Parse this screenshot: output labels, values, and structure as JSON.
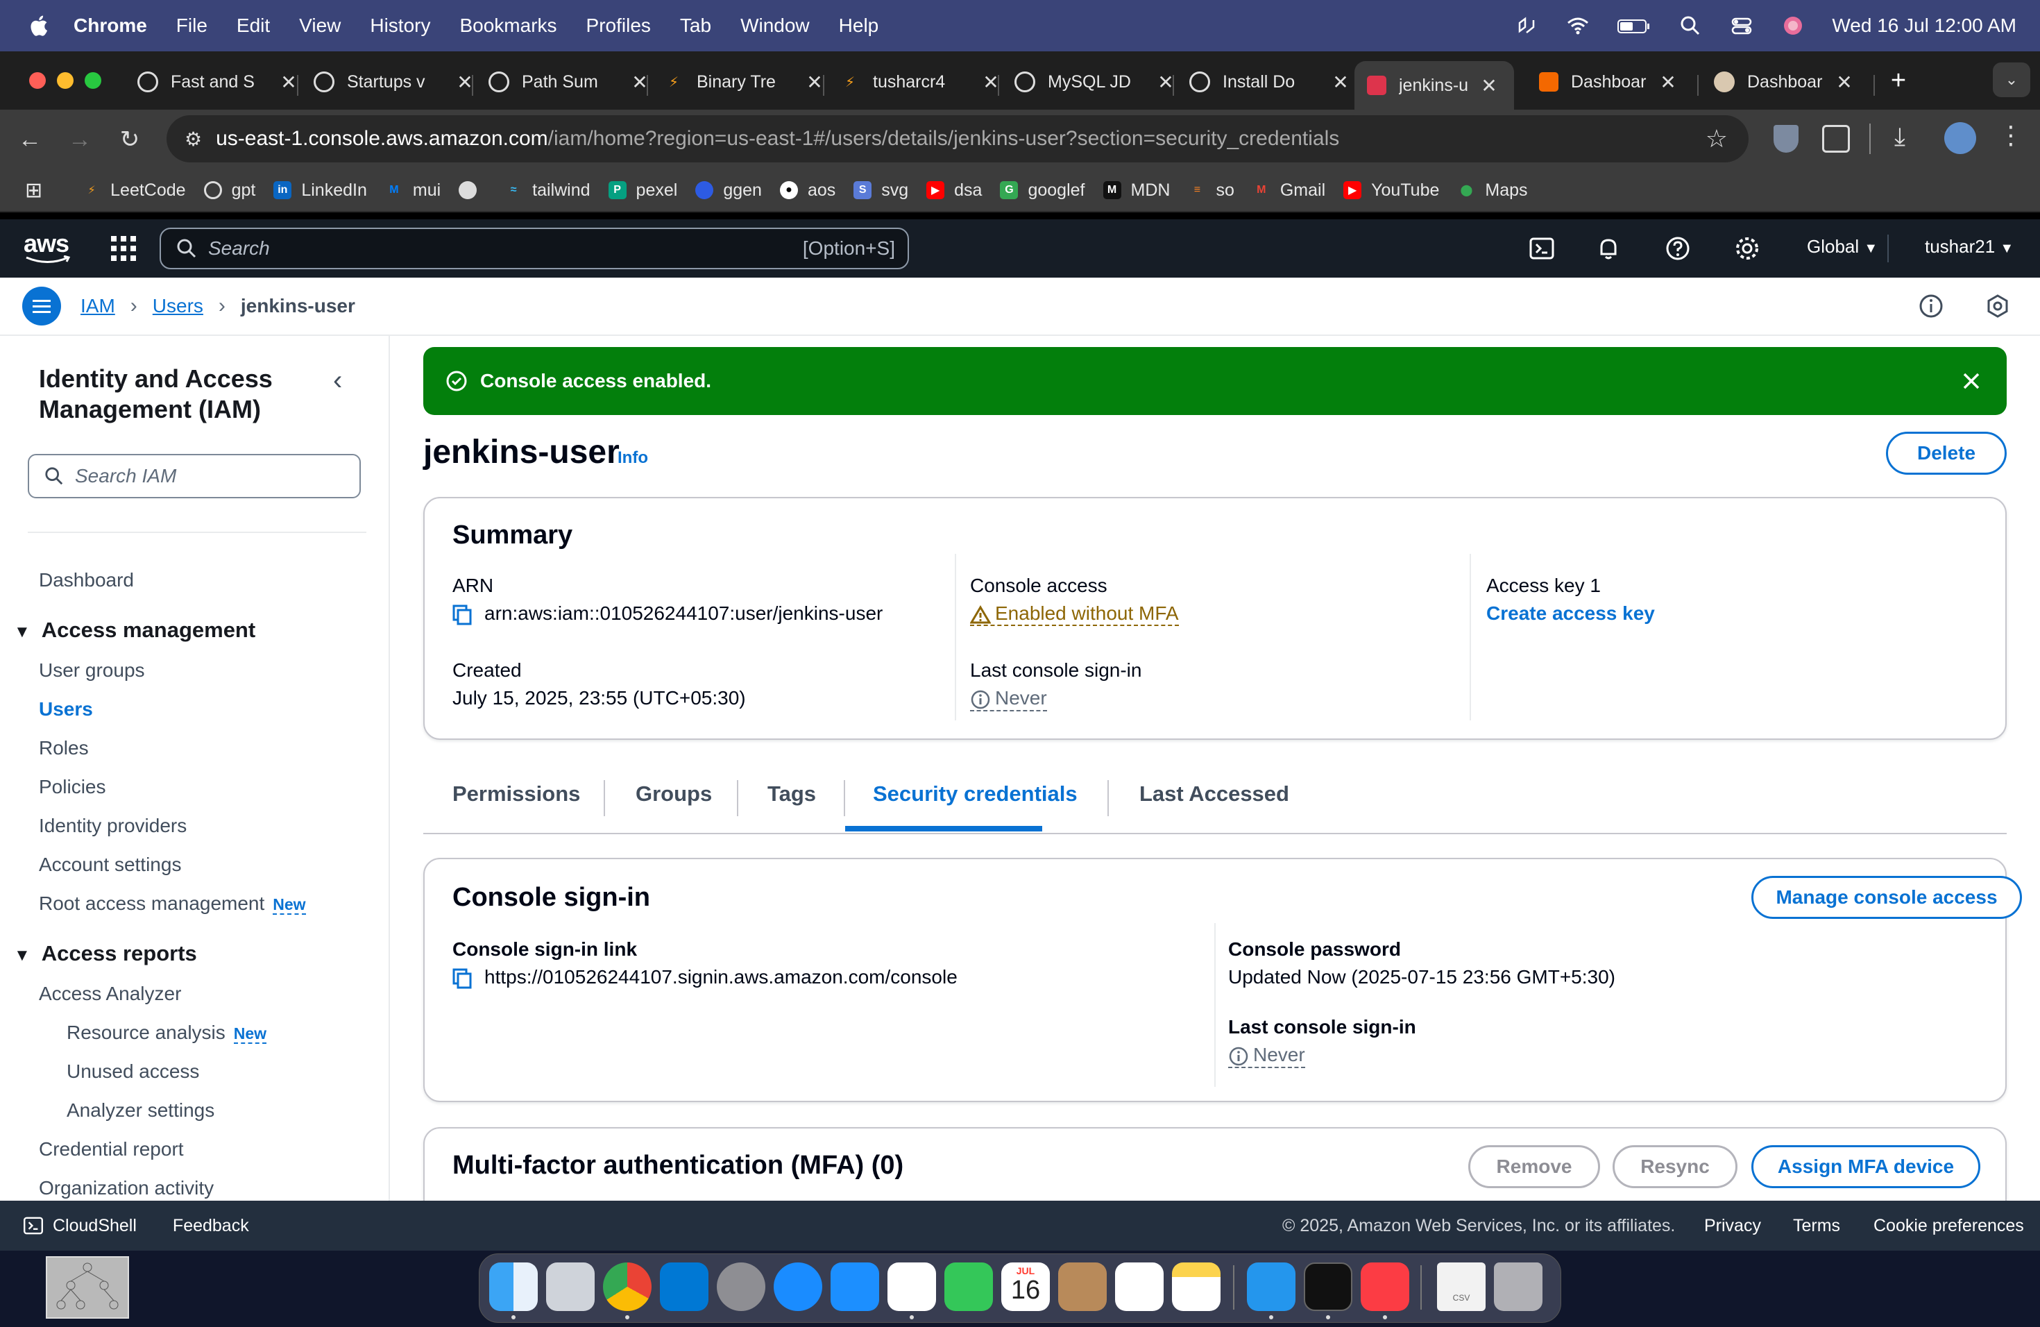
{
  "menubar": {
    "app_name": "Chrome",
    "items": [
      "File",
      "Edit",
      "View",
      "History",
      "Bookmarks",
      "Profiles",
      "Tab",
      "Window",
      "Help"
    ],
    "datetime": "Wed 16 Jul  12:00 AM"
  },
  "tabs": [
    {
      "label": "Fast and S",
      "icon": "openai-icon"
    },
    {
      "label": "Startups v",
      "icon": "openai-icon"
    },
    {
      "label": "Path Sum",
      "icon": "openai-icon"
    },
    {
      "label": "Binary Tre",
      "icon": "leetcode-icon"
    },
    {
      "label": "tusharcr4",
      "icon": "leetcode-icon"
    },
    {
      "label": "MySQL JD",
      "icon": "openai-icon"
    },
    {
      "label": "Install Do",
      "icon": "openai-icon"
    },
    {
      "label": "jenkins-u",
      "icon": "aws-iam-icon",
      "active": true
    },
    {
      "label": "Dashboar",
      "icon": "orange-dashboard-icon"
    },
    {
      "label": "Dashboar",
      "icon": "jenkins-icon"
    }
  ],
  "address": {
    "host": "us-east-1.console.aws.amazon.com",
    "path": "/iam/home?region=us-east-1#/users/details/jenkins-user?section=security_credentials"
  },
  "bookmarks": [
    {
      "label": "LeetCode",
      "icon": "leetcode-icon",
      "color": "#f89f1b"
    },
    {
      "label": "gpt",
      "icon": "openai-icon",
      "color": "#555555"
    },
    {
      "label": "LinkedIn",
      "icon": "linkedin-icon",
      "color": "#0a66c2"
    },
    {
      "label": "mui",
      "icon": "mui-icon",
      "color": "#007fff"
    },
    {
      "label": "",
      "icon": "globe-icon",
      "color": "#888888"
    },
    {
      "label": "tailwind",
      "icon": "tailwind-icon",
      "color": "#38bdf8"
    },
    {
      "label": "pexel",
      "icon": "pexels-icon",
      "color": "#05a081"
    },
    {
      "label": "ggen",
      "icon": "ggen-icon",
      "color": "#2d5be3"
    },
    {
      "label": "aos",
      "icon": "github-icon",
      "color": "#333333"
    },
    {
      "label": "svg",
      "icon": "svg-icon",
      "color": "#5a7bd8"
    },
    {
      "label": "dsa",
      "icon": "youtube-icon",
      "color": "#ff0000"
    },
    {
      "label": "googlef",
      "icon": "google-fonts-icon",
      "color": "#34a853"
    },
    {
      "label": "MDN",
      "icon": "mdn-icon",
      "color": "#222222"
    },
    {
      "label": "so",
      "icon": "stackoverflow-icon",
      "color": "#f48024"
    },
    {
      "label": "Gmail",
      "icon": "gmail-icon",
      "color": "#ea4335"
    },
    {
      "label": "YouTube",
      "icon": "youtube-icon",
      "color": "#ff0000"
    },
    {
      "label": "Maps",
      "icon": "maps-icon",
      "color": "#34a853"
    }
  ],
  "aws_nav": {
    "logo": "aws",
    "search_placeholder": "Search",
    "search_shortcut": "[Option+S]",
    "region": "Global",
    "account": "tushar21"
  },
  "breadcrumb": [
    "IAM",
    "Users",
    "jenkins-user"
  ],
  "sidebar": {
    "title": "Identity and Access Management (IAM)",
    "search_placeholder": "Search IAM",
    "dashboard": "Dashboard",
    "access_management": "Access management",
    "am_items": [
      "User groups",
      "Users",
      "Roles",
      "Policies",
      "Identity providers",
      "Account settings",
      "Root access management"
    ],
    "access_reports": "Access reports",
    "ar_items": [
      "Access Analyzer",
      "Resource analysis",
      "Unused access",
      "Analyzer settings",
      "Credential report",
      "Organization activity"
    ],
    "new_badge": "New"
  },
  "flash": {
    "message": "Console access enabled."
  },
  "page": {
    "title": "jenkins-user",
    "info": "Info",
    "delete": "Delete"
  },
  "summary": {
    "title": "Summary",
    "arn_label": "ARN",
    "arn_value": "arn:aws:iam::010526244107:user/jenkins-user",
    "created_label": "Created",
    "created_value": "July 15, 2025, 23:55 (UTC+05:30)",
    "console_access_label": "Console access",
    "console_access_value": "Enabled without MFA",
    "last_signin_label": "Last console sign-in",
    "last_signin_value": "Never",
    "access_key_label": "Access key 1",
    "create_access_key": "Create access key"
  },
  "tabs_main": [
    "Permissions",
    "Groups",
    "Tags",
    "Security credentials",
    "Last Accessed"
  ],
  "console_signin": {
    "title": "Console sign-in",
    "manage_button": "Manage console access",
    "link_label": "Console sign-in link",
    "link_value": "https://010526244107.signin.aws.amazon.com/console",
    "password_label": "Console password",
    "password_value": "Updated Now (2025-07-15 23:56 GMT+5:30)",
    "last_signin_label": "Last console sign-in",
    "last_signin_value": "Never"
  },
  "mfa": {
    "title": "Multi-factor authentication (MFA) (0)",
    "remove": "Remove",
    "resync": "Resync",
    "assign": "Assign MFA device"
  },
  "footer": {
    "cloudshell": "CloudShell",
    "feedback": "Feedback",
    "copyright": "© 2025, Amazon Web Services, Inc. or its affiliates.",
    "privacy": "Privacy",
    "terms": "Terms",
    "cookie": "Cookie preferences"
  },
  "dock": {
    "calendar_month": "JUL",
    "calendar_day": "16",
    "apps": [
      "finder-icon",
      "launchpad-icon",
      "chrome-icon",
      "vscode-icon",
      "system-settings-icon",
      "safari-icon",
      "app-store-icon",
      "photos-icon",
      "facetime-icon",
      "calendar-icon",
      "contacts-icon",
      "reminders-icon",
      "notes-icon",
      "docker-icon",
      "terminal-icon",
      "music-icon",
      "csv-file-icon",
      "trash-icon"
    ],
    "file_label": "CSV"
  },
  "colors": {
    "aws_nav_bg": "#161d26",
    "link_blue": "#0972d3",
    "success_green": "#037f0c",
    "warning_text": "#8d6605"
  }
}
